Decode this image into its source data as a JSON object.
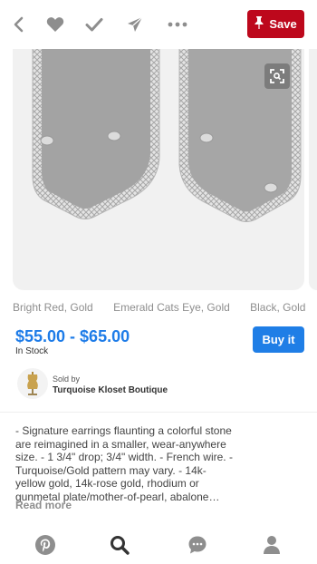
{
  "toolbar": {
    "back_icon": "chevron-left-icon",
    "like_icon": "heart-icon",
    "tried_icon": "check-icon",
    "send_icon": "send-icon",
    "more_icon": "more-icon",
    "save_label": "Save"
  },
  "product": {
    "image_description_icon": "earring-image",
    "variants": [
      "Bright Red,  Gold",
      "Emerald Cats Eye,  Gold",
      "Black,  Gold"
    ],
    "price": "$55.00 - $65.00",
    "stock": "In Stock",
    "buy_label": "Buy it"
  },
  "seller": {
    "sold_by": "Sold by",
    "name": "Turquoise Kloset Boutique"
  },
  "description": {
    "text": "- Signature earrings flaunting a colorful stone are reimagined in a smaller, wear-anywhere size. - 1 3/4\" drop; 3/4\" width. - French wire. - Turquoise/Gold pattern may vary. - 14k-yellow gold, 14k-rose gold, rhodium or gunmetal plate/mother-of-pearl, abalone…",
    "read_more": "Read more"
  },
  "bottom_nav": {
    "items": [
      "pinterest-icon",
      "search-icon",
      "chat-icon",
      "profile-icon"
    ]
  },
  "colors": {
    "save_red": "#bd081c",
    "price_blue": "#1e7ce8",
    "buy_blue": "#1f7ee6"
  }
}
